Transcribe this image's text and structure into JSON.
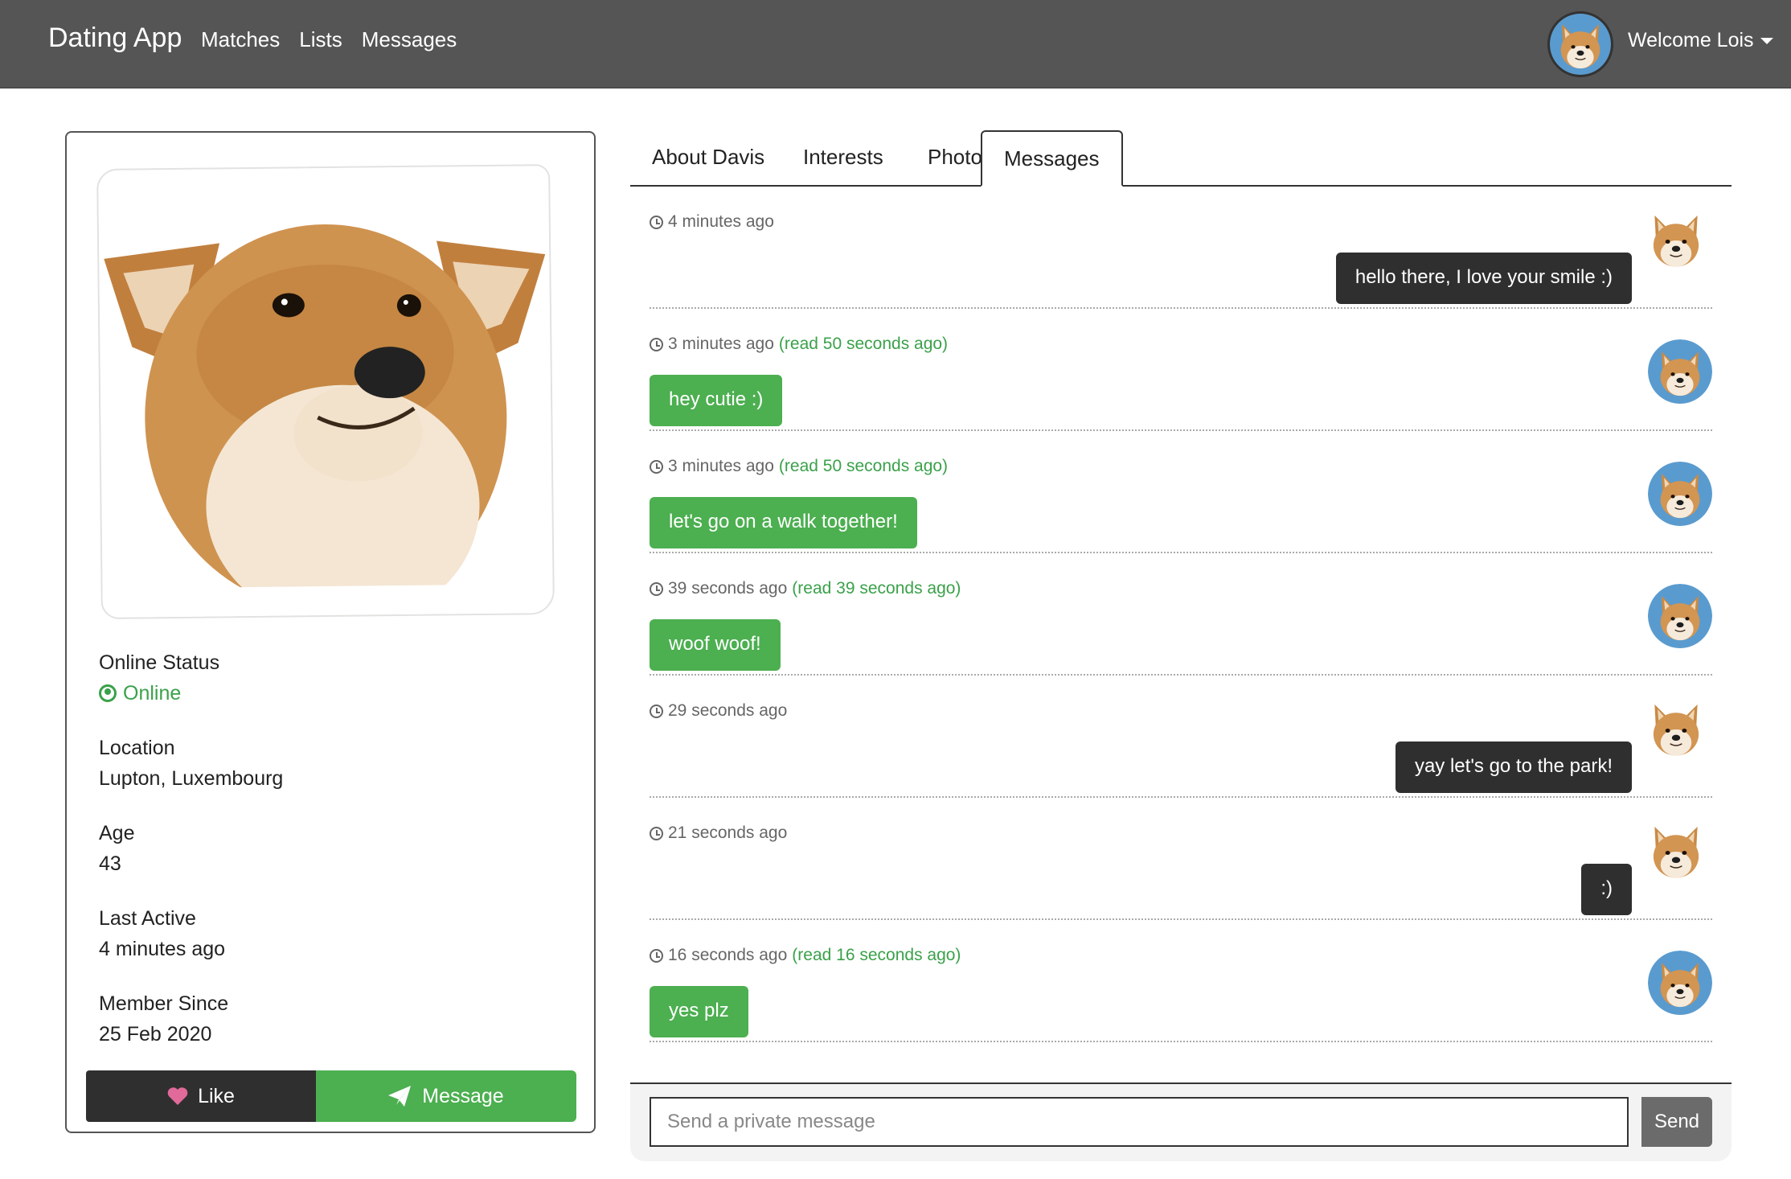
{
  "navbar": {
    "brand": "Dating App",
    "links": [
      "Matches",
      "Lists",
      "Messages"
    ],
    "welcome": "Welcome Lois"
  },
  "profile": {
    "online_status_label": "Online Status",
    "online_status_value": "Online",
    "location_label": "Location",
    "location_value": "Lupton, Luxembourg",
    "age_label": "Age",
    "age_value": "43",
    "last_active_label": "Last Active",
    "last_active_value": "4 minutes ago",
    "member_since_label": "Member Since",
    "member_since_value": "25 Feb 2020",
    "like_label": "Like",
    "message_label": "Message"
  },
  "tabs": [
    "About Davis",
    "Interests",
    "Photos",
    "Messages"
  ],
  "active_tab": "Messages",
  "messages": [
    {
      "time": "4 minutes ago",
      "read": "",
      "text": "hello there, I love your smile :)",
      "direction": "out"
    },
    {
      "time": "3 minutes ago",
      "read": "(read 50 seconds ago)",
      "text": "hey cutie :)",
      "direction": "in"
    },
    {
      "time": "3 minutes ago",
      "read": "(read 50 seconds ago)",
      "text": "let's go on a walk together!",
      "direction": "in"
    },
    {
      "time": "39 seconds ago",
      "read": "(read 39 seconds ago)",
      "text": "woof woof!",
      "direction": "in"
    },
    {
      "time": "29 seconds ago",
      "read": "",
      "text": "yay let's go to the park!",
      "direction": "out"
    },
    {
      "time": "21 seconds ago",
      "read": "",
      "text": ":)",
      "direction": "out"
    },
    {
      "time": "16 seconds ago",
      "read": "(read 16 seconds ago)",
      "text": "yes plz",
      "direction": "in"
    }
  ],
  "send": {
    "placeholder": "Send a private message",
    "button_label": "Send"
  },
  "colors": {
    "navbar": "#555555",
    "accent_green": "#4caf50",
    "dark_bubble": "#2f2f2f"
  }
}
